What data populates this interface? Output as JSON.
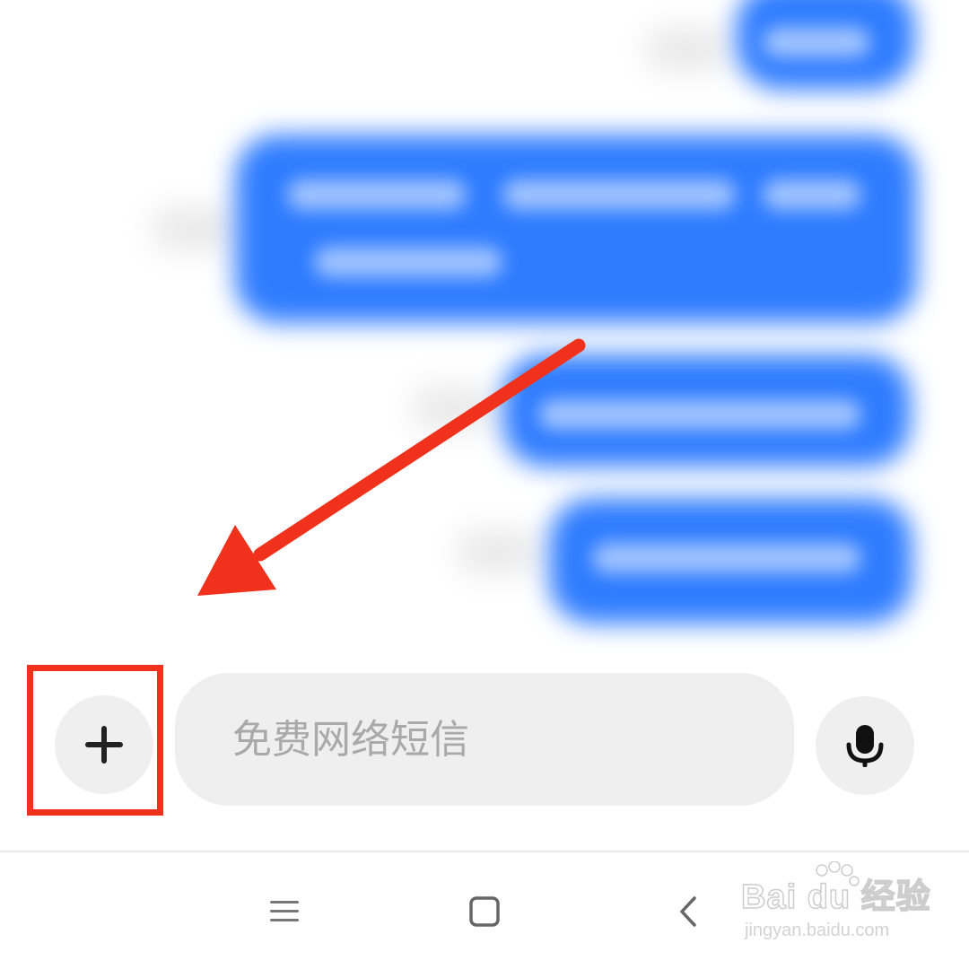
{
  "composer": {
    "placeholder": "免费网络短信",
    "value": "",
    "add_button_icon": "plus-icon",
    "voice_button_icon": "microphone-icon"
  },
  "navigation_bar": {
    "items": [
      {
        "name": "menu",
        "icon": "menu-icon"
      },
      {
        "name": "home",
        "icon": "square-home-icon"
      },
      {
        "name": "back",
        "icon": "chevron-left-icon"
      }
    ]
  },
  "annotation": {
    "arrow_color": "#f0321c",
    "highlight_color": "#f0321c"
  },
  "chat": {
    "bubble_color": "#2f7cff"
  },
  "watermark": {
    "brand": "Bai du 经验",
    "url": "jingyan.baidu.com"
  }
}
